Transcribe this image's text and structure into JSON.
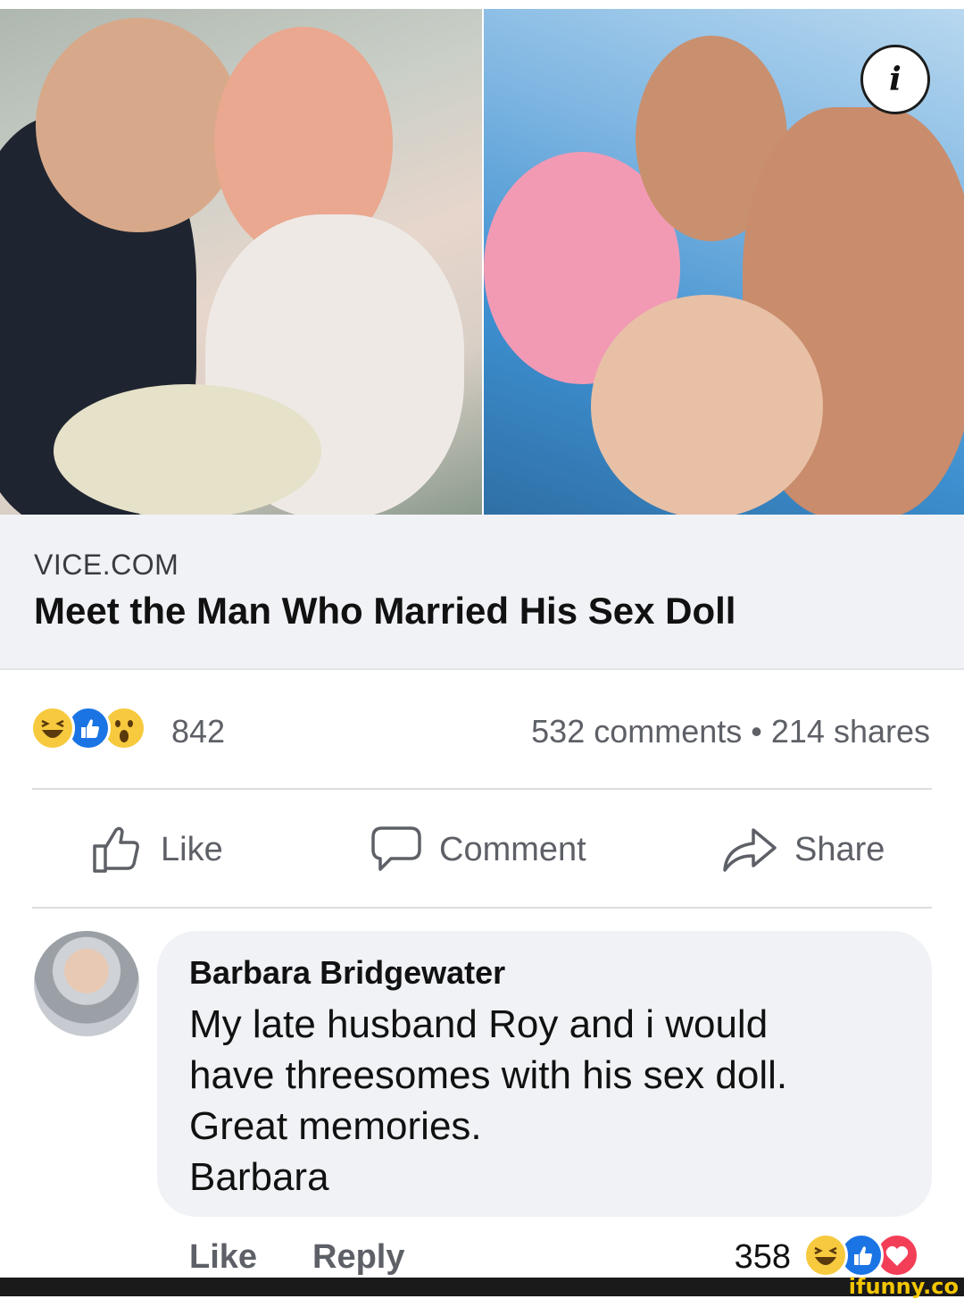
{
  "post": {
    "link_domain": "VICE.COM",
    "link_title": "Meet the Man Who Married His Sex Doll",
    "reaction_icons": [
      "haha-icon",
      "like-icon",
      "wow-icon"
    ],
    "reaction_count": "842",
    "comments_shares": "532 comments • 214 shares"
  },
  "actions": {
    "like": "Like",
    "comment": "Comment",
    "share": "Share"
  },
  "comment": {
    "author": "Barbara Bridgewater",
    "lines": [
      "My late husband Roy and i would",
      "have threesomes with his sex doll.",
      "Great memories.",
      "Barbara"
    ],
    "like_label": "Like",
    "reply_label": "Reply",
    "reaction_count": "358",
    "reaction_icons": [
      "haha-icon",
      "like-icon",
      "love-icon"
    ]
  },
  "watermark": "ifunny.co",
  "colors": {
    "facebook_blue": "#1b74e4",
    "haha_yellow": "#f7c93e",
    "love_red": "#f33e58",
    "meta_gray": "#5e6067",
    "card_bg": "#f1f2f6",
    "bubble_bg": "#f0f2f5"
  }
}
